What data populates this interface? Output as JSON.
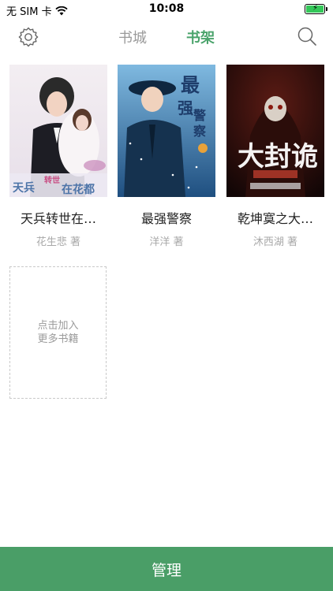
{
  "status_bar": {
    "carrier": "无 SIM 卡",
    "time": "10:08",
    "battery_icon": "charging-battery-icon"
  },
  "nav": {
    "settings_icon": "gear-icon",
    "search_icon": "search-icon",
    "tabs": [
      {
        "label": "书城",
        "active": false
      },
      {
        "label": "书架",
        "active": true
      }
    ]
  },
  "books": [
    {
      "title": "天兵转世在…",
      "author": "花生悲 著",
      "cover_text": "天兵 转世 在花都"
    },
    {
      "title": "最强警察",
      "author": "洋洋 著",
      "cover_text": "最强警察"
    },
    {
      "title": "乾坤寞之大…",
      "author": "沐西湖 著",
      "cover_text": "大封诡"
    }
  ],
  "add_card": {
    "line1": "点击加入",
    "line2": "更多书籍"
  },
  "bottom": {
    "label": "管理"
  },
  "colors": {
    "accent": "#4aa36b",
    "bottom_bar": "#4a9e67"
  }
}
